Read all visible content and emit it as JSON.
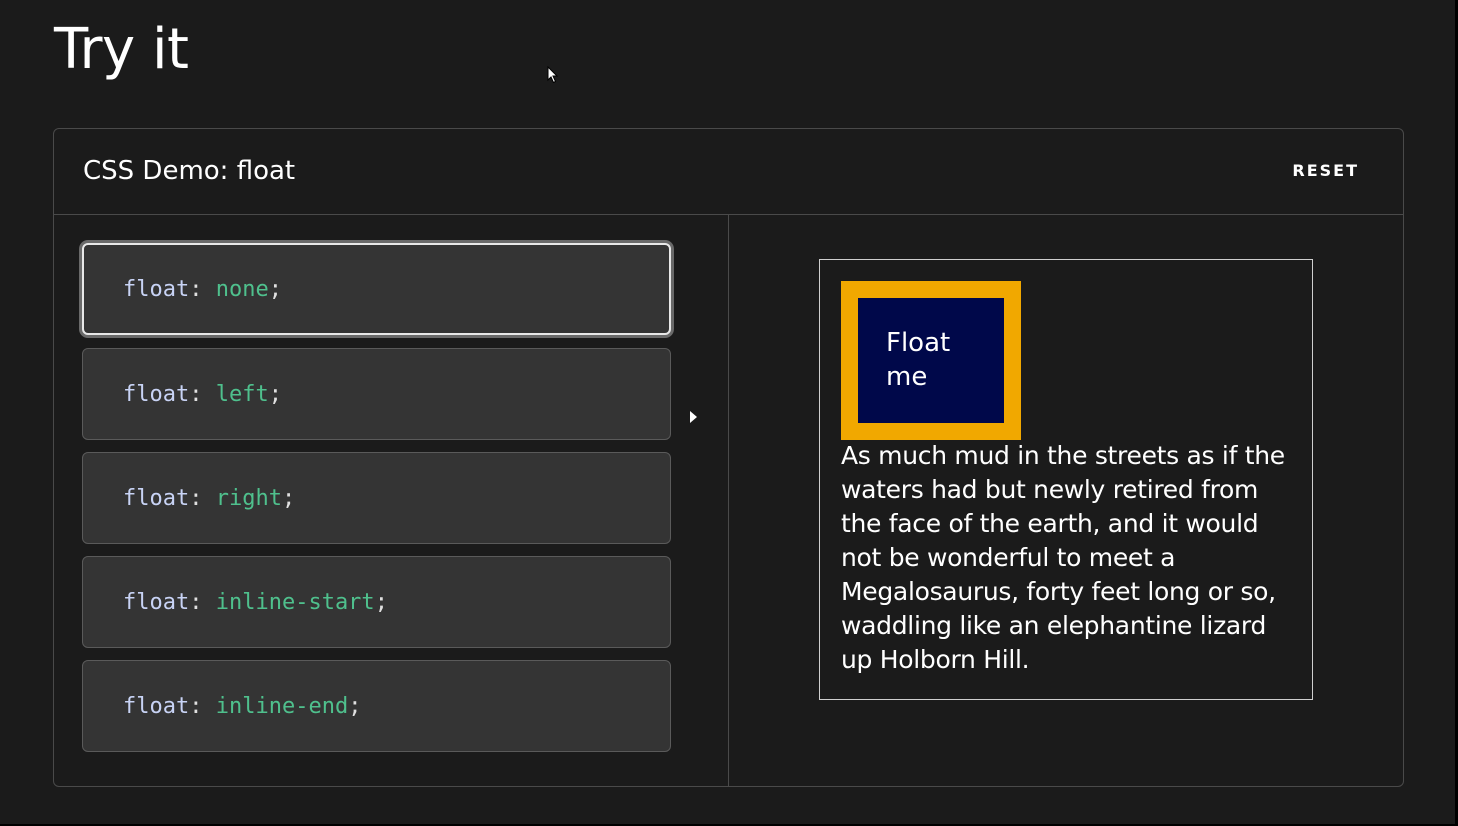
{
  "page": {
    "title": "Try it"
  },
  "demo": {
    "title": "CSS Demo: float",
    "reset_label": "RESET",
    "choices": [
      {
        "property": "float",
        "colon": ":",
        "value": "none",
        "semicolon": ";",
        "selected": true
      },
      {
        "property": "float",
        "colon": ":",
        "value": "left",
        "semicolon": ";",
        "selected": false
      },
      {
        "property": "float",
        "colon": ":",
        "value": "right",
        "semicolon": ";",
        "selected": false
      },
      {
        "property": "float",
        "colon": ":",
        "value": "inline-start",
        "semicolon": ";",
        "selected": false
      },
      {
        "property": "float",
        "colon": ":",
        "value": "inline-end",
        "semicolon": ";",
        "selected": false
      }
    ],
    "play_icon": "play-triangle-icon"
  },
  "output": {
    "float_label": "Float me",
    "paragraph": "As much mud in the streets as if the waters had but newly retired from the face of the earth, and it would not be wonderful to meet a Megalosaurus, forty feet long or so, waddling like an elephantine lizard up Holborn Hill."
  },
  "colors": {
    "background": "#1b1b1b",
    "choice_background": "#343434",
    "value_color": "#4fc08d",
    "float_border": "#f1a800",
    "float_background": "#00084a"
  }
}
